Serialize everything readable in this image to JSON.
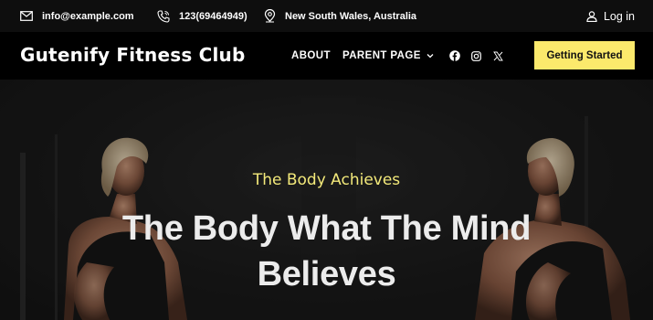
{
  "topbar": {
    "email": "info@example.com",
    "phone": "123(69464949)",
    "location": "New South Wales, Australia",
    "login_label": "Log in"
  },
  "header": {
    "brand": "Gutenify Fitness Club",
    "nav": [
      {
        "label": "ABOUT"
      },
      {
        "label": "PARENT PAGE"
      }
    ],
    "social_icons": [
      "facebook-icon",
      "instagram-icon",
      "x-icon"
    ],
    "cta_label": "Getting Started"
  },
  "hero": {
    "subtitle": "The Body Achieves",
    "title": "The Body What The Mind Believes"
  },
  "colors": {
    "accent": "#fbe96c",
    "subtitle": "#f3e97a",
    "header_bg": "#000000",
    "topbar_bg": "#0e0e0e"
  }
}
